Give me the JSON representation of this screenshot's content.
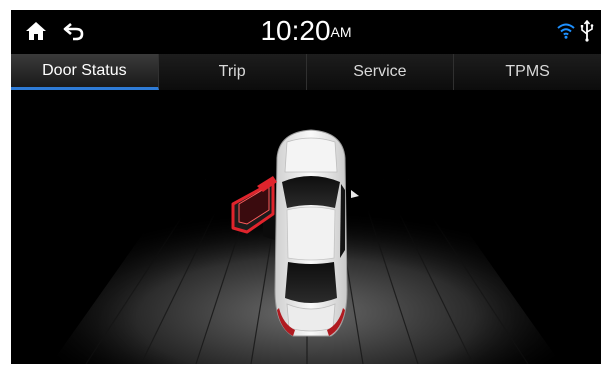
{
  "statusbar": {
    "time": "10:20",
    "ampm": "AM",
    "icons": {
      "home": "home-icon",
      "back": "back-icon",
      "wifi": "wifi-icon",
      "usb": "usb-icon"
    },
    "wifi_color": "#1e90ff"
  },
  "tabs": [
    {
      "label": "Door Status",
      "active": true
    },
    {
      "label": "Trip",
      "active": false
    },
    {
      "label": "Service",
      "active": false
    },
    {
      "label": "TPMS",
      "active": false
    }
  ],
  "door_status": {
    "open_door": "front-left",
    "highlight_color": "#e0242c"
  }
}
